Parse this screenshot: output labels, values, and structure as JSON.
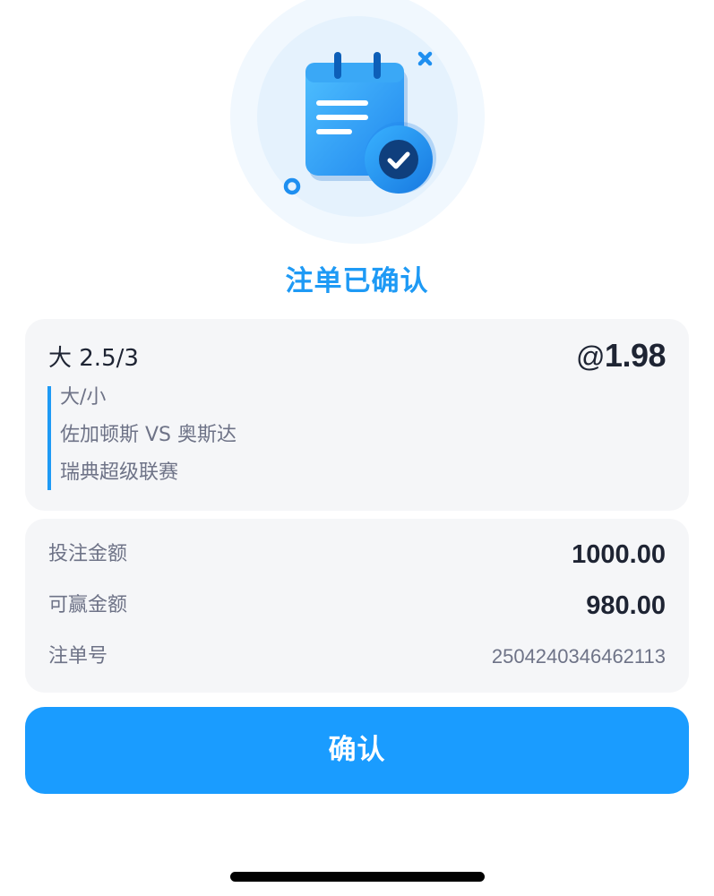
{
  "colors": {
    "accent": "#1a9cff",
    "title": "#1e9af5",
    "card_bg": "#f5f6f8",
    "text_primary": "#1e2433",
    "text_secondary": "#6e7387"
  },
  "header": {
    "icon": "calendar-check-icon",
    "title": "注单已确认"
  },
  "bet": {
    "selection": "大 2.5/3",
    "odds_prefix": "@",
    "odds": "1.98",
    "market": "大/小",
    "match": "佐加顿斯 VS 奥斯达",
    "league": "瑞典超级联赛"
  },
  "summary": {
    "stake_label": "投注金额",
    "stake_value": "1000.00",
    "win_label": "可赢金额",
    "win_value": "980.00",
    "ticket_label": "注单号",
    "ticket_value": "2504240346462113"
  },
  "actions": {
    "confirm_label": "确认"
  }
}
